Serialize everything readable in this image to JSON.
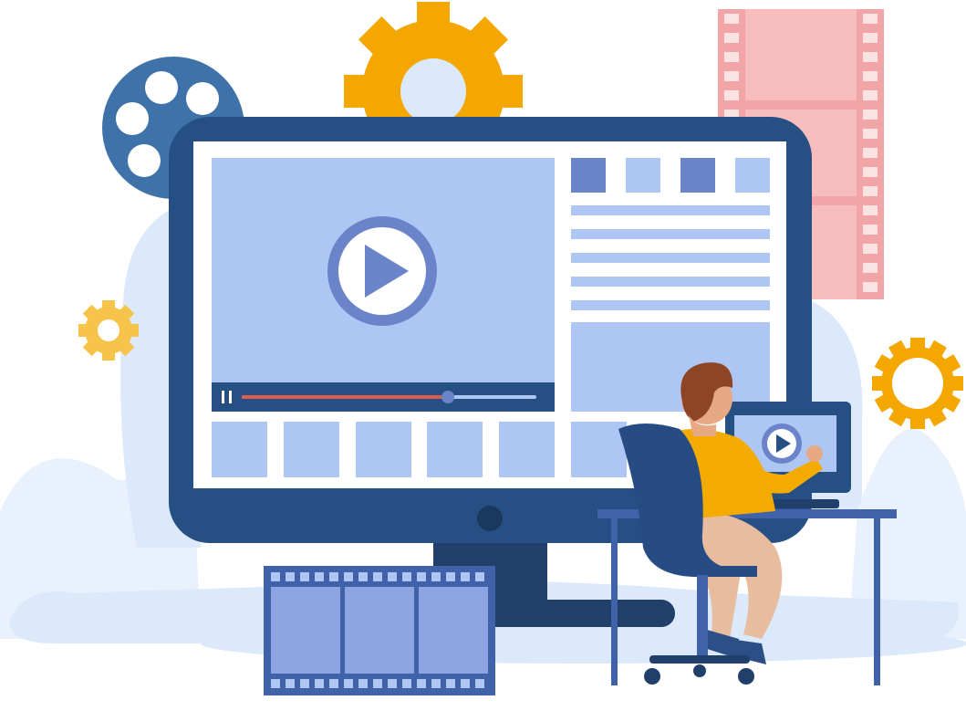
{
  "illustration": {
    "subject": "video-player-workstation",
    "icons": [
      "film-reel-icon",
      "gear-icon",
      "film-strip-icon",
      "play-icon",
      "pause-icon"
    ],
    "colors": {
      "monitor_frame": "#264f83",
      "screen_panel": "#aec6f3",
      "accent_blue": "#6b84c9",
      "gear_orange": "#f4a700",
      "gear_light": "#f7c44b",
      "film_pink": "#f7bdbd",
      "film_pink_dark": "#f1a5a6",
      "background_blob": "#dbe9fb",
      "progress_played": "#e25c4e",
      "sweater": "#f4ab00",
      "hair": "#8e4526",
      "trousers": "#e7bc9f",
      "chair": "#274c84"
    }
  },
  "video_player": {
    "progress_fraction": 0.7,
    "paused": true
  }
}
